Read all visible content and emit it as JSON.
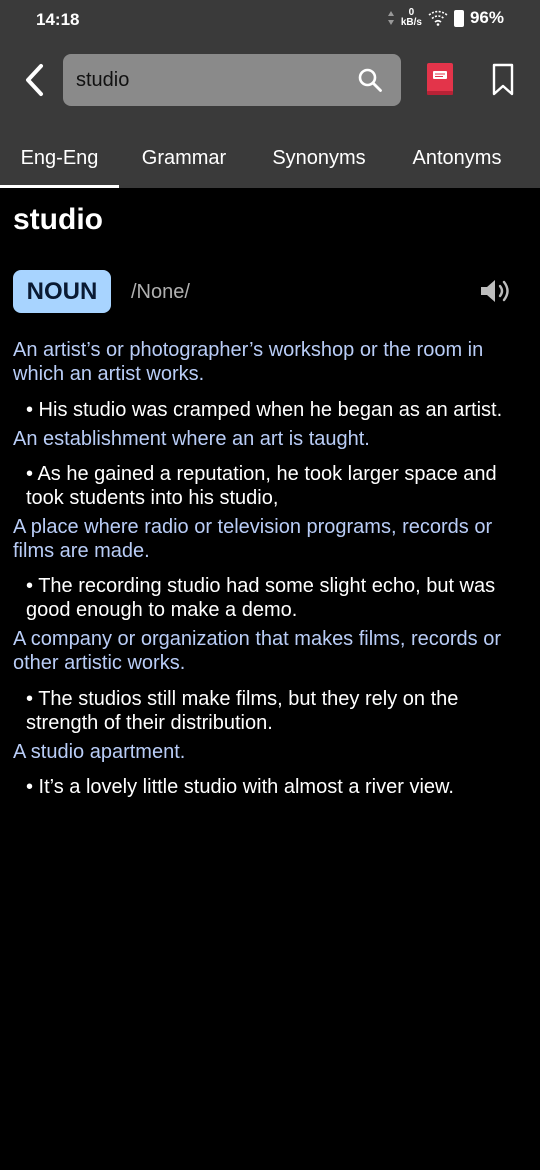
{
  "status": {
    "time": "14:18",
    "net_top": "0",
    "net_bottom": "kB/s",
    "battery": "96%"
  },
  "search": {
    "value": "studio",
    "placeholder": ""
  },
  "icons": {
    "back": "back-arrow-icon",
    "search": "search-icon",
    "book": "book-icon",
    "bookmark": "bookmark-icon",
    "speaker": "speaker-icon"
  },
  "colors": {
    "topbar": "#3a3a3a",
    "search_box": "#8a8a8a",
    "badge": "#a8d4ff",
    "definition": "#b9cdf7",
    "book_icon": "#e3344a"
  },
  "tabs": [
    {
      "label": "Eng-Eng",
      "active": true
    },
    {
      "label": "Grammar",
      "active": false
    },
    {
      "label": "Synonyms",
      "active": false
    },
    {
      "label": "Antonyms",
      "active": false
    }
  ],
  "entry": {
    "word": "studio",
    "pos": "NOUN",
    "pronunciation": "/None/",
    "senses": [
      {
        "definition": "An artist’s or photographer’s workshop or the room in which an artist works.",
        "example": "• His studio was cramped when he began as an artist."
      },
      {
        "definition": "An establishment where an art is taught.",
        "example": "• As he gained a reputation, he took larger space and took students into his studio,"
      },
      {
        "definition": "A place where radio or television programs, records or films are made.",
        "example": "• The recording studio had some slight echo, but was good enough to make a demo."
      },
      {
        "definition": "A company or organization that makes films, records or other artistic works.",
        "example": "• The studios still make films, but they rely on the strength of their distribution."
      },
      {
        "definition": "A studio apartment.",
        "example": "• It’s a lovely little studio with almost a river view."
      }
    ]
  }
}
